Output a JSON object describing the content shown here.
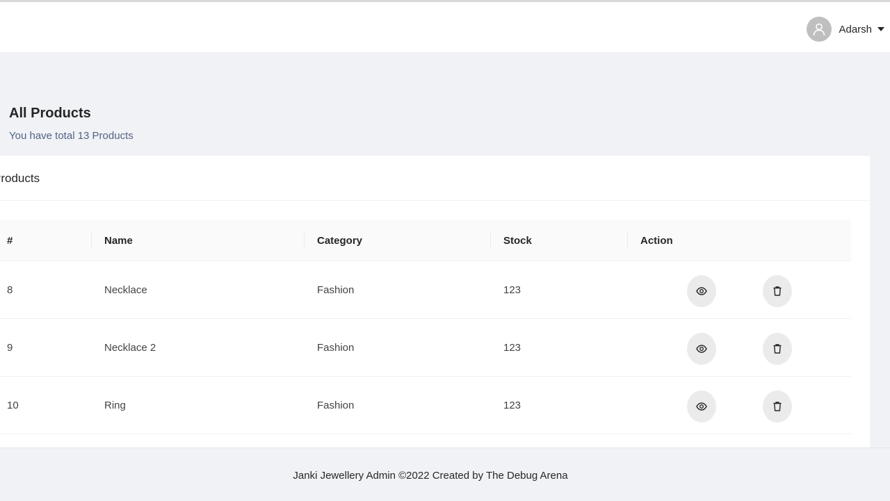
{
  "header": {
    "username": "Adarsh"
  },
  "page": {
    "title": "All Products",
    "subtitle": "You have total 13 Products"
  },
  "card": {
    "title": "Products"
  },
  "table": {
    "columns": [
      "#",
      "Name",
      "Category",
      "Stock",
      "Action"
    ],
    "rows": [
      {
        "id": "8",
        "name": "Necklace",
        "category": "Fashion",
        "stock": "123"
      },
      {
        "id": "9",
        "name": "Necklace 2",
        "category": "Fashion",
        "stock": "123"
      },
      {
        "id": "10",
        "name": "Ring",
        "category": "Fashion",
        "stock": "123"
      }
    ],
    "actions": {
      "view_icon": "eye-icon",
      "delete_icon": "trash-icon"
    }
  },
  "footer": {
    "text": "Janki Jewellery Admin ©2022 Created by The Debug Arena"
  }
}
